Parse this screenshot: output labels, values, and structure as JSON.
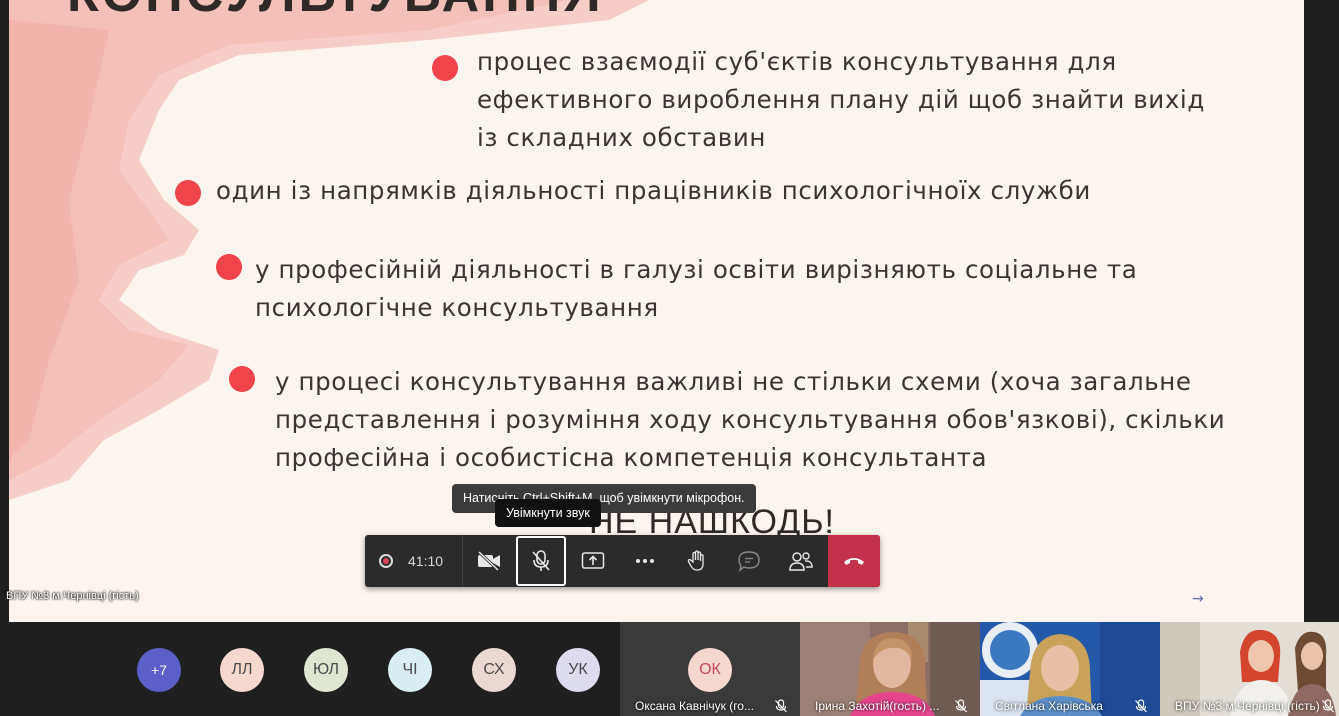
{
  "slide": {
    "title": "КОНСУЛЬТУВАННЯ",
    "bullets": [
      "процес взаємодії суб'єктів консультування для ефективного вироблення плану дій щоб знайти вихід із складних обставин",
      "один із напрямків діяльності працівників психологічноїх служби",
      "у професійній діяльності в галузі освіти вирізняють соціальне та психологічне консультування",
      "у процесі консультування важливі не стільки схеми (хоча загальне представлення і розуміння ходу консультування обов'язкові), скільки професійна і особистісна компетенція консультанта"
    ],
    "bullet_lines": [
      [
        "процес взаємодії суб'єктів консультування для",
        "ефективного вироблення плану дій щоб знайти вихід",
        "із складних обставин"
      ],
      [
        "один із напрямків діяльності працівників психологічноїх служби"
      ],
      [
        "у професійній діяльності в галузі освіти вирізняють соціальне та",
        "психологічне консультування"
      ],
      [
        "у процесі консультування важливі не стільки схеми (хоча загальне",
        "представлення і розуміння ходу консультування обов'язкові), скільки",
        "професійна і особистісна компетенція консультанта"
      ]
    ],
    "motto": "НЕ НАШКОДЬ!",
    "bullet_color": "#f1434b",
    "presenter_label": "ВПУ №3 м.Чернівці (гість)"
  },
  "tooltips": {
    "hotkey": "Натисніть Ctrl+Shift+M, щоб увімкнути мікрофон.",
    "unmute": "Увімкнути звук"
  },
  "controls": {
    "timer": "41:10",
    "hangup_color": "#c4314b"
  },
  "participants": {
    "overflow": "+7",
    "avatars": [
      {
        "initials": "ЛЛ",
        "color": "#f6d8cf"
      },
      {
        "initials": "ЮЛ",
        "color": "#dfe6d3"
      },
      {
        "initials": "ЧІ",
        "color": "#d9eef2"
      },
      {
        "initials": "СХ",
        "color": "#ead9d3"
      },
      {
        "initials": "УК",
        "color": "#dcdcee"
      }
    ],
    "tiles": [
      {
        "initials": "ОК",
        "name": "Оксана Кавнічук (го..."
      },
      {
        "name": "Ірина Захотій(гость) ..."
      },
      {
        "name": "Світлана Харівська"
      },
      {
        "name": "ВПУ №3 м.Чернівці (гість)"
      }
    ]
  }
}
